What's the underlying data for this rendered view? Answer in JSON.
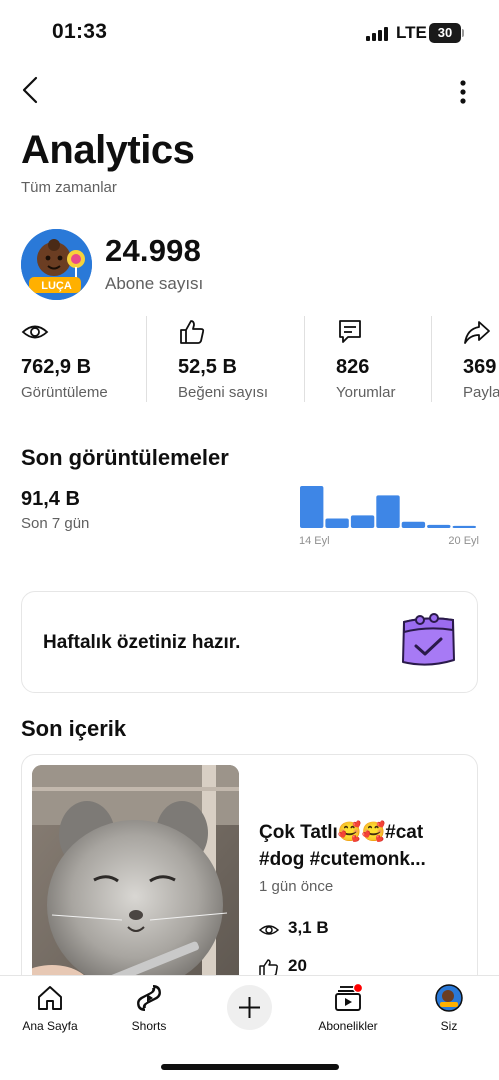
{
  "status_bar": {
    "time": "01:33",
    "network": "LTE",
    "battery": "30"
  },
  "header": {
    "title": "Analytics",
    "subtitle": "Tüm zamanlar"
  },
  "channel": {
    "avatar_text": "LUÇA",
    "subscribers": "24.998",
    "subscribers_label": "Abone sayısı"
  },
  "metrics": [
    {
      "icon": "eye-icon",
      "value": "762,9 B",
      "label": "Görüntüleme"
    },
    {
      "icon": "thumbs-up-icon",
      "value": "52,5 B",
      "label": "Beğeni sayısı"
    },
    {
      "icon": "comment-icon",
      "value": "826",
      "label": "Yorumlar"
    },
    {
      "icon": "share-icon",
      "value": "369",
      "label": "Paylaşım"
    }
  ],
  "recent_views": {
    "title": "Son görüntülemeler",
    "value": "91,4 B",
    "period": "Son 7 gün",
    "chart_data": {
      "type": "bar",
      "values": [
        40,
        9,
        12,
        31,
        6,
        3,
        2
      ],
      "x_start_label": "14 Eyl",
      "x_end_label": "20 Eyl",
      "color": "#3e86e6"
    }
  },
  "digest": {
    "text": "Haftalık özetiniz hazır."
  },
  "recent_content": {
    "title": "Son içerik",
    "video": {
      "title": "Çok Tatlı🥰🥰#cat #dog  #cutemonk...",
      "age": "1 gün önce",
      "views": "3,1 B",
      "likes": "20"
    }
  },
  "tab_bar": {
    "items": [
      {
        "icon": "home-icon",
        "label": "Ana Sayfa"
      },
      {
        "icon": "shorts-icon",
        "label": "Shorts"
      },
      {
        "icon": "plus-icon",
        "label": ""
      },
      {
        "icon": "subscriptions-icon",
        "label": "Abonelikler"
      },
      {
        "icon": "avatar-icon",
        "label": "Siz"
      }
    ]
  },
  "colors": {
    "accent_blue": "#3e86e6",
    "digest_purple": "#9b6cf0",
    "notification_red": "#ff0000",
    "text_secondary": "#606060"
  }
}
